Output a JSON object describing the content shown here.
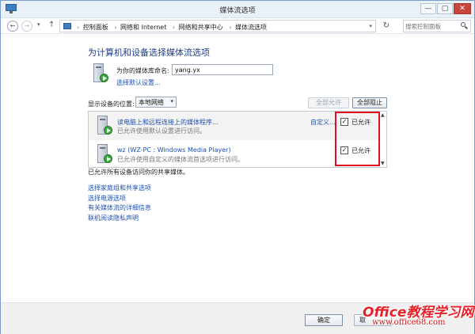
{
  "window": {
    "title": "媒体流选项",
    "controls": {
      "minimize": "—",
      "maximize": "▢",
      "close": "✕"
    }
  },
  "nav": {
    "breadcrumbs": [
      "控制面板",
      "网络和 Internet",
      "网络和共享中心",
      "媒体流选项"
    ],
    "search_placeholder": "搜索控制面板",
    "icons": [
      "back-arrow-icon",
      "forward-arrow-icon",
      "up-arrow-icon",
      "refresh-icon",
      "search-icon"
    ]
  },
  "page": {
    "title": "为计算机和设备选择媒体流选项",
    "library": {
      "label": "为你的媒体库命名:",
      "value": "yang.yx",
      "default_link": "选择默认设置..."
    },
    "filter": {
      "label": "显示设备的位置:",
      "selected": "本地网络",
      "allow_all": "全部允许",
      "block_all": "全部阻止"
    },
    "devices": [
      {
        "title": "读电脑上和远程连接上的媒体程序...",
        "desc": "已允许使用默认设置进行访问。",
        "customize": "自定义...",
        "checked": true,
        "allowed_label": "已允许"
      },
      {
        "title": "wz (WZ-PC : Windows Media Player)",
        "desc": "已允许使用自定义的媒体流首选项进行访问。",
        "customize": "",
        "checked": true,
        "allowed_label": "已允许"
      }
    ],
    "allowed_note": "已允许所有设备访问你的共享媒体。",
    "links": [
      "选择家庭组和共享选项",
      "选择电源选项",
      "有关媒体流的详细信息",
      "联机阅读隐私声明"
    ]
  },
  "footer": {
    "ok": "确定",
    "cancel": "取"
  },
  "watermark": {
    "title": "Office教程学习网",
    "url": "www.office68.com"
  },
  "colors": {
    "link": "#1e50b4",
    "title_blue": "#1e3f8a",
    "highlight_red": "#e0101e",
    "close_red": "#c9463d"
  }
}
